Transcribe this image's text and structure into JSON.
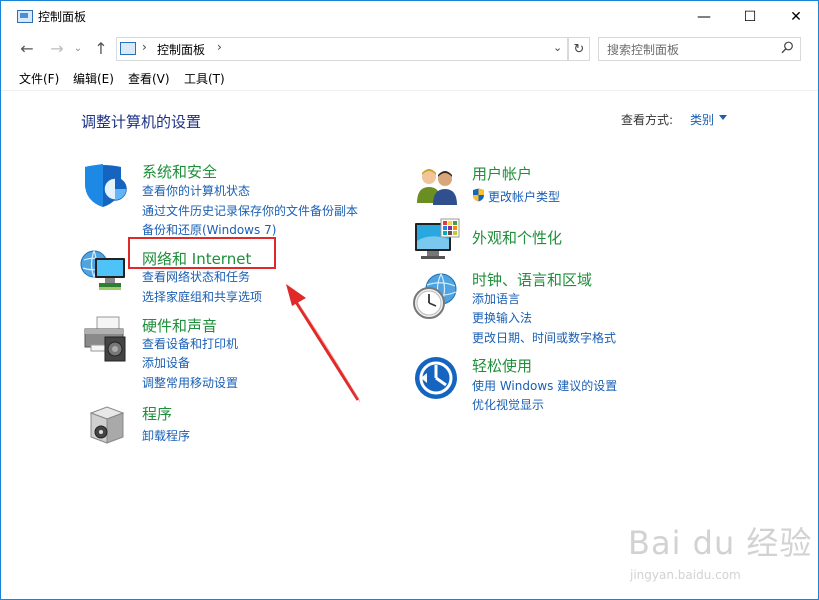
{
  "window": {
    "title": "控制面板",
    "minimize": "—",
    "maximize": "☐",
    "close": "✕"
  },
  "navigation": {
    "back": "←",
    "forward": "→",
    "history": "⌄",
    "up": "↑",
    "address_sep": "›",
    "address": "控制面板",
    "refresh": "↻",
    "search_placeholder": "搜索控制面板",
    "search_glyph": "⚲"
  },
  "menu": [
    "文件(F)",
    "编辑(E)",
    "查看(V)",
    "工具(T)"
  ],
  "page": {
    "title": "调整计算机的设置",
    "view_by_label": "查看方式:",
    "view_by_value": "类别"
  },
  "categories_left": [
    {
      "title": "系统和安全",
      "icon": "shield-icon",
      "links": [
        "查看你的计算机状态",
        "通过文件历史记录保存你的文件备份副本",
        "备份和还原(Windows 7)"
      ]
    },
    {
      "title": "网络和 Internet",
      "icon": "network-globe-icon",
      "links": [
        "查看网络状态和任务",
        "选择家庭组和共享选项"
      ]
    },
    {
      "title": "硬件和声音",
      "icon": "printer-speaker-icon",
      "links": [
        "查看设备和打印机",
        "添加设备",
        "调整常用移动设置"
      ]
    },
    {
      "title": "程序",
      "icon": "programs-box-icon",
      "links": [
        "卸载程序"
      ]
    }
  ],
  "categories_right": [
    {
      "title": "用户帐户",
      "icon": "users-icon",
      "links": [
        "更改帐户类型"
      ]
    },
    {
      "title": "外观和个性化",
      "icon": "monitor-palette-icon",
      "links": []
    },
    {
      "title": "时钟、语言和区域",
      "icon": "clock-globe-icon",
      "links": [
        "添加语言",
        "更换输入法",
        "更改日期、时间或数字格式"
      ]
    },
    {
      "title": "轻松使用",
      "icon": "ease-of-access-icon",
      "links": [
        "使用 Windows 建议的设置",
        "优化视觉显示"
      ]
    }
  ],
  "watermark": {
    "brand": "Bai du 经验",
    "url": "jingyan.baidu.com"
  },
  "colors": {
    "title_green": "#1e8f3a",
    "link_blue": "#1a5fb4",
    "heading_navy": "#1e3287",
    "annotation_red": "#e02a2a"
  }
}
